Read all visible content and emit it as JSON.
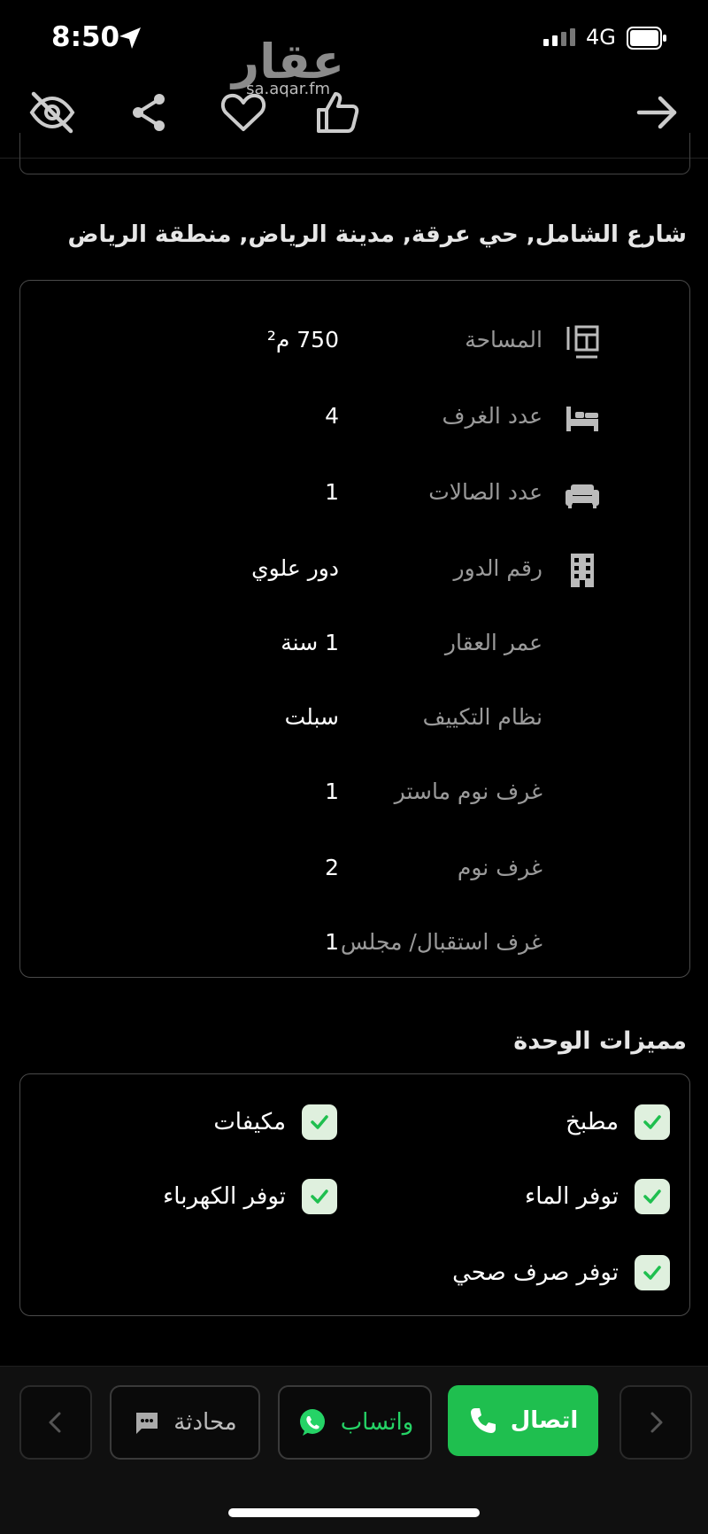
{
  "status_bar": {
    "time": "8:50",
    "network": "4G"
  },
  "watermark": {
    "brand": "عقار",
    "site": "sa.aqar.fm"
  },
  "address": "شارع الشامل, حي عرقة, مدينة الرياض, منطقة الرياض",
  "details": [
    {
      "label": "المساحة",
      "value": "750 م²",
      "icon": "area-icon"
    },
    {
      "label": "عدد الغرف",
      "value": "4",
      "icon": "bed-icon"
    },
    {
      "label": "عدد الصالات",
      "value": "1",
      "icon": "sofa-icon"
    },
    {
      "label": "رقم الدور",
      "value": "دور علوي",
      "icon": "building-icon"
    },
    {
      "label": "عمر العقار",
      "value": "1 سنة",
      "icon": ""
    },
    {
      "label": "نظام التكييف",
      "value": "سبلت",
      "icon": ""
    },
    {
      "label": "غرف نوم ماستر",
      "value": "1",
      "icon": ""
    },
    {
      "label": "غرف نوم",
      "value": "2",
      "icon": ""
    },
    {
      "label": "غرف استقبال/ مجلس",
      "value": "1",
      "icon": ""
    }
  ],
  "features": {
    "title": "مميزات الوحدة",
    "items": [
      "مطبخ",
      "مكيفات",
      "توفر الماء",
      "توفر الكهرباء",
      "توفر صرف صحي"
    ]
  },
  "actions": {
    "call_label": "اتصال",
    "whatsapp_label": "واتساب",
    "chat_label": "محادثة"
  },
  "colors": {
    "accent_green": "#1fbf4f",
    "whatsapp_green": "#25d366",
    "check_bg": "#dff0de"
  }
}
